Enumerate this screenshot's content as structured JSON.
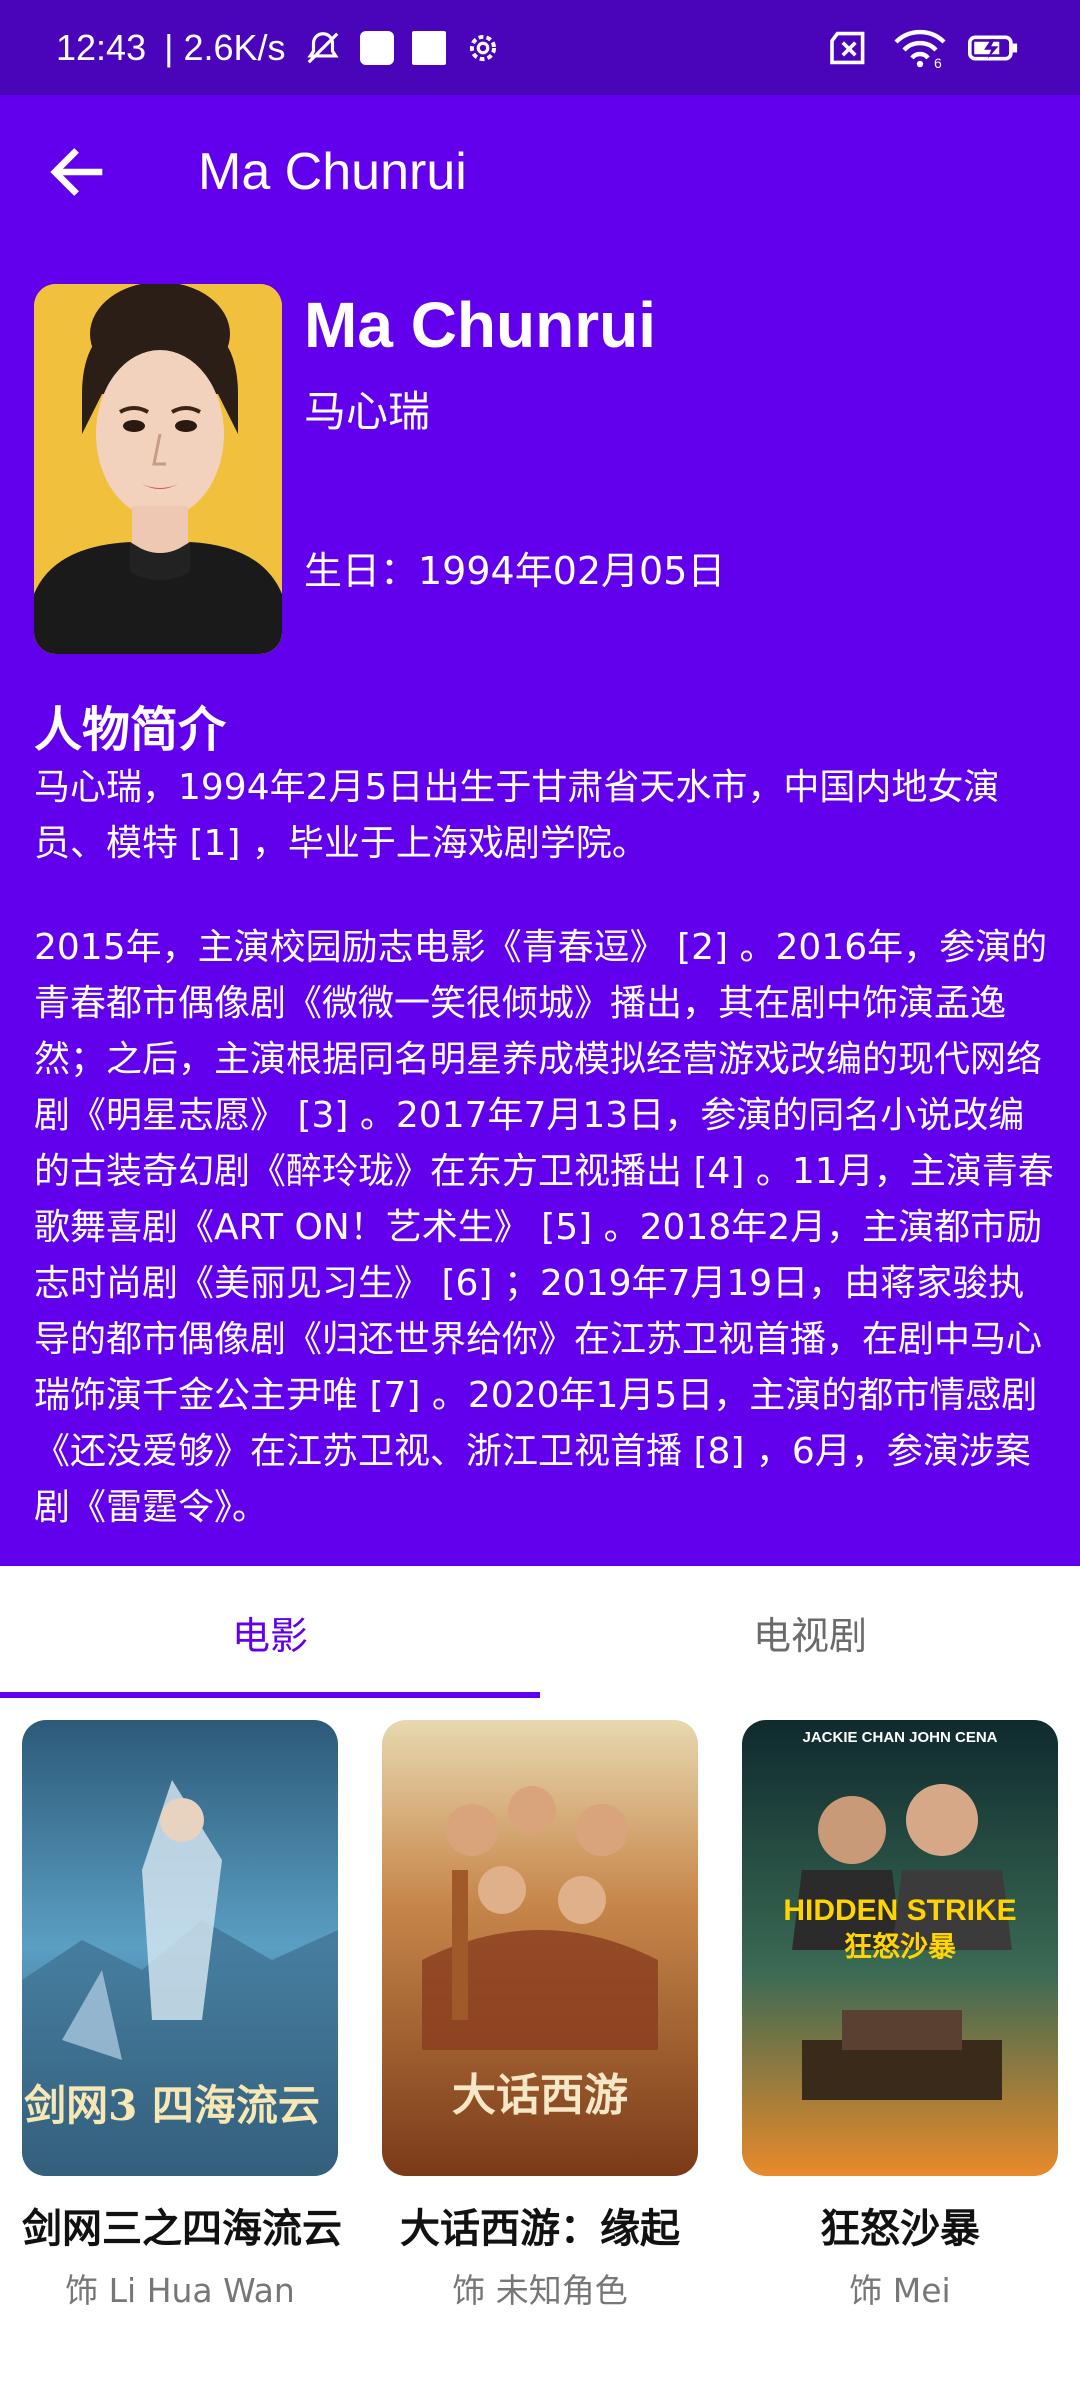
{
  "status_bar": {
    "time": "12:43",
    "speed": "| 2.6K/s",
    "wifi_badge": "6"
  },
  "app_bar": {
    "title": "Ma Chunrui"
  },
  "profile": {
    "name_en": "Ma Chunrui",
    "name_cn": "马心瑞",
    "birthday": "生日：1994年02月05日",
    "bio_title": "人物简介",
    "bio_paragraphs": [
      "马心瑞，1994年2月5日出生于甘肃省天水市，中国内地女演员、模特 [1] ，毕业于上海戏剧学院。",
      "2015年，主演校园励志电影《青春逗》 [2] 。2016年，参演的青春都市偶像剧《微微一笑很倾城》播出，其在剧中饰演孟逸然；之后，主演根据同名明星养成模拟经营游戏改编的现代网络剧《明星志愿》 [3] 。2017年7月13日，参演的同名小说改编的古装奇幻剧《醉玲珑》在东方卫视播出 [4] 。11月，主演青春歌舞喜剧《ART ON！艺术生》 [5] 。2018年2月，主演都市励志时尚剧《美丽见习生》 [6] ；2019年7月19日，由蒋家骏执导的都市偶像剧《归还世界给你》在江苏卫视首播，在剧中马心瑞饰演千金公主尹唯 [7] 。2020年1月5日，主演的都市情感剧《还没爱够》在江苏卫视、浙江卫视首播 [8] ，6月，参演涉案剧《雷霆令》。"
    ]
  },
  "tabs": [
    {
      "label": "电影",
      "active": true
    },
    {
      "label": "电视剧",
      "active": false
    }
  ],
  "movies": [
    {
      "title": "剑网三之四海流云",
      "role": "饰 Li Hua Wan",
      "poster_text": "剑网3 四海流云"
    },
    {
      "title": "大话西游：缘起",
      "role": "饰 未知角色",
      "poster_text": "大话西游"
    },
    {
      "title": "狂怒沙暴",
      "role": "饰 Mei",
      "poster_text_en": "HIDDEN STRIKE",
      "poster_text_cn": "狂怒沙暴",
      "poster_actors": "JACKIE CHAN  JOHN CENA"
    }
  ],
  "colors": {
    "primary": "#6200ee",
    "status_bar": "#4a04ba"
  }
}
